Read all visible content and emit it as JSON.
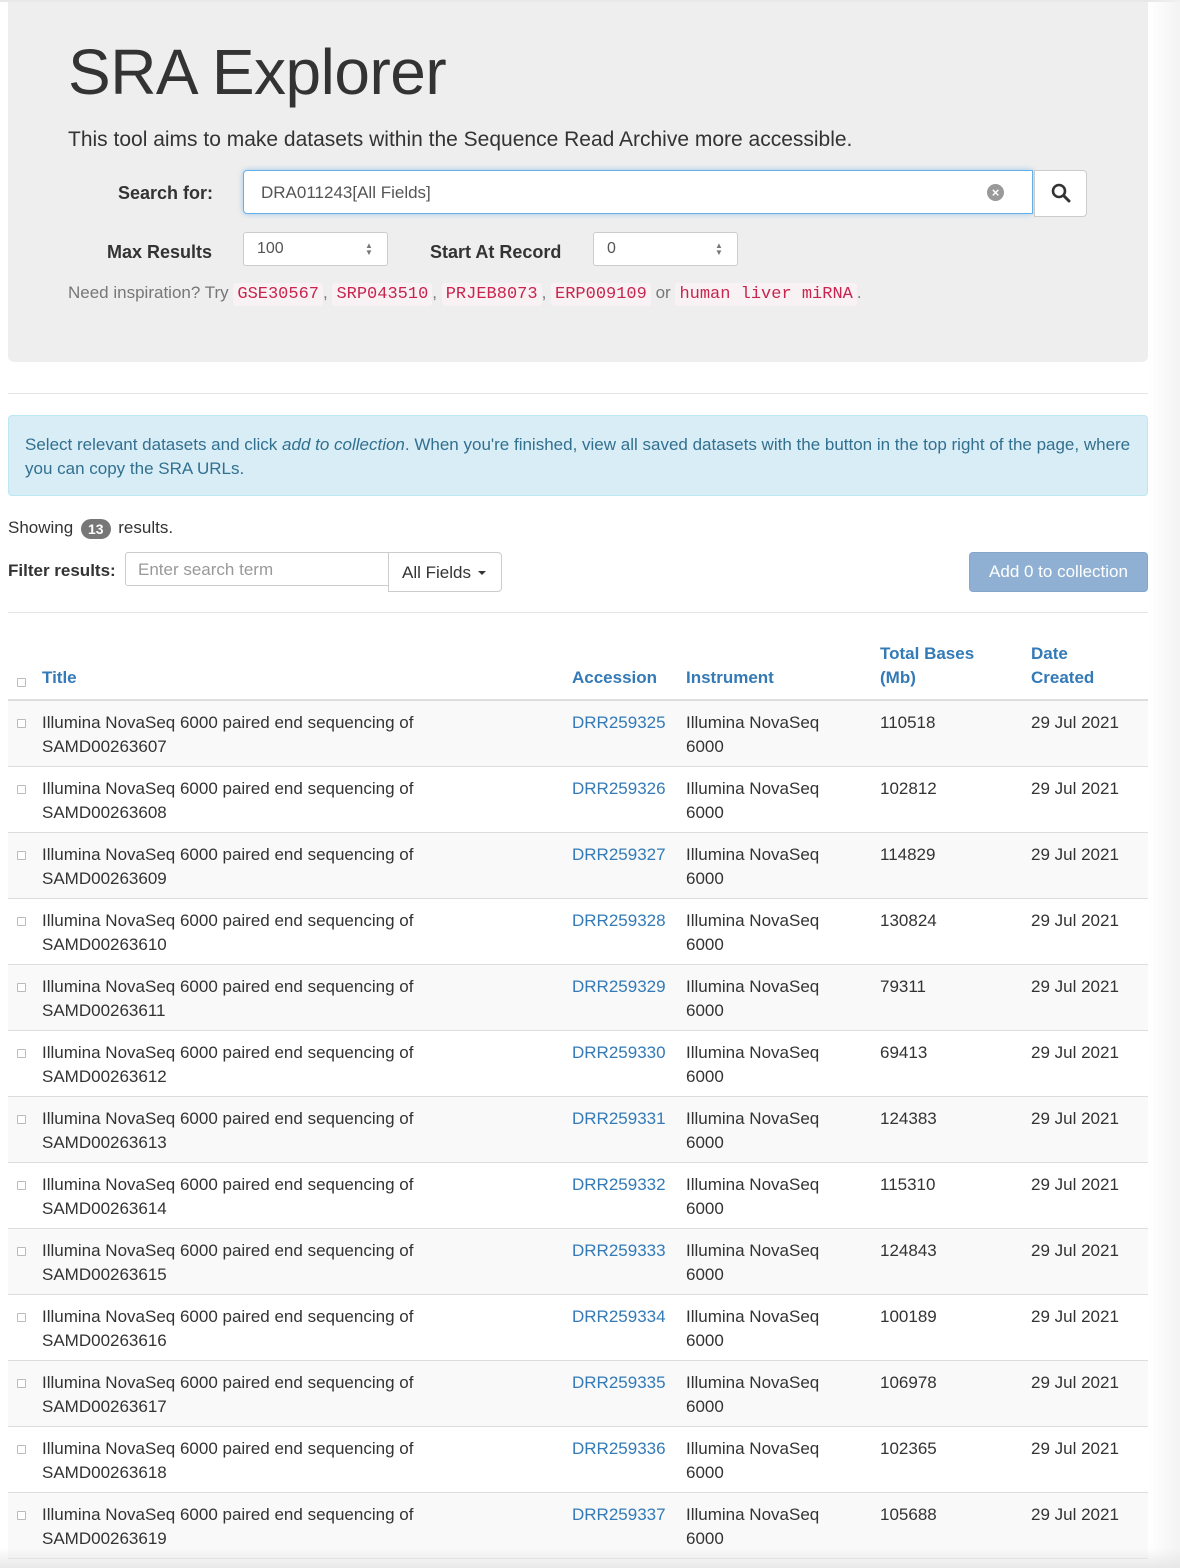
{
  "header": {
    "title": "SRA Explorer",
    "lead": "This tool aims to make datasets within the Sequence Read Archive more accessible."
  },
  "search": {
    "label": "Search for:",
    "value": "DRA011243[All Fields]",
    "clear_icon": "circle-x-icon",
    "button_icon": "magnifier-icon"
  },
  "max_results": {
    "label": "Max Results",
    "value": "100"
  },
  "start_record": {
    "label": "Start At Record",
    "value": "0"
  },
  "inspiration": {
    "prefix": "Need inspiration? Try",
    "examples": [
      "GSE30567",
      "SRP043510",
      "PRJEB8073",
      "ERP009109"
    ],
    "or_text": "or",
    "last_example": "human liver miRNA",
    "end": "."
  },
  "alert": {
    "before": "Select relevant datasets and click ",
    "em": "add to collection",
    "after": ". When you're finished, view all saved datasets with the button in the top right of the page, where you can copy the SRA URLs."
  },
  "showing": {
    "prefix": "Showing",
    "count": "13",
    "suffix": "results."
  },
  "filter": {
    "label": "Filter results:",
    "placeholder": "Enter search term",
    "fields_button": "All Fields",
    "add_button": "Add 0 to collection"
  },
  "table": {
    "headers": {
      "title": "Title",
      "accession": "Accession",
      "instrument": "Instrument",
      "bases_line1": "Total Bases",
      "bases_line2": "(Mb)",
      "date_line1": "Date",
      "date_line2": "Created"
    },
    "rows": [
      {
        "title1": "Illumina NovaSeq 6000 paired end sequencing of",
        "title2": "SAMD00263607",
        "accession": "DRR259325",
        "instrument1": "Illumina NovaSeq",
        "instrument2": "6000",
        "bases": "110518",
        "date": "29 Jul 2021"
      },
      {
        "title1": "Illumina NovaSeq 6000 paired end sequencing of",
        "title2": "SAMD00263608",
        "accession": "DRR259326",
        "instrument1": "Illumina NovaSeq",
        "instrument2": "6000",
        "bases": "102812",
        "date": "29 Jul 2021"
      },
      {
        "title1": "Illumina NovaSeq 6000 paired end sequencing of",
        "title2": "SAMD00263609",
        "accession": "DRR259327",
        "instrument1": "Illumina NovaSeq",
        "instrument2": "6000",
        "bases": "114829",
        "date": "29 Jul 2021"
      },
      {
        "title1": "Illumina NovaSeq 6000 paired end sequencing of",
        "title2": "SAMD00263610",
        "accession": "DRR259328",
        "instrument1": "Illumina NovaSeq",
        "instrument2": "6000",
        "bases": "130824",
        "date": "29 Jul 2021"
      },
      {
        "title1": "Illumina NovaSeq 6000 paired end sequencing of",
        "title2": "SAMD00263611",
        "accession": "DRR259329",
        "instrument1": "Illumina NovaSeq",
        "instrument2": "6000",
        "bases": "79311",
        "date": "29 Jul 2021"
      },
      {
        "title1": "Illumina NovaSeq 6000 paired end sequencing of",
        "title2": "SAMD00263612",
        "accession": "DRR259330",
        "instrument1": "Illumina NovaSeq",
        "instrument2": "6000",
        "bases": "69413",
        "date": "29 Jul 2021"
      },
      {
        "title1": "Illumina NovaSeq 6000 paired end sequencing of",
        "title2": "SAMD00263613",
        "accession": "DRR259331",
        "instrument1": "Illumina NovaSeq",
        "instrument2": "6000",
        "bases": "124383",
        "date": "29 Jul 2021"
      },
      {
        "title1": "Illumina NovaSeq 6000 paired end sequencing of",
        "title2": "SAMD00263614",
        "accession": "DRR259332",
        "instrument1": "Illumina NovaSeq",
        "instrument2": "6000",
        "bases": "115310",
        "date": "29 Jul 2021"
      },
      {
        "title1": "Illumina NovaSeq 6000 paired end sequencing of",
        "title2": "SAMD00263615",
        "accession": "DRR259333",
        "instrument1": "Illumina NovaSeq",
        "instrument2": "6000",
        "bases": "124843",
        "date": "29 Jul 2021"
      },
      {
        "title1": "Illumina NovaSeq 6000 paired end sequencing of",
        "title2": "SAMD00263616",
        "accession": "DRR259334",
        "instrument1": "Illumina NovaSeq",
        "instrument2": "6000",
        "bases": "100189",
        "date": "29 Jul 2021"
      },
      {
        "title1": "Illumina NovaSeq 6000 paired end sequencing of",
        "title2": "SAMD00263617",
        "accession": "DRR259335",
        "instrument1": "Illumina NovaSeq",
        "instrument2": "6000",
        "bases": "106978",
        "date": "29 Jul 2021"
      },
      {
        "title1": "Illumina NovaSeq 6000 paired end sequencing of",
        "title2": "SAMD00263618",
        "accession": "DRR259336",
        "instrument1": "Illumina NovaSeq",
        "instrument2": "6000",
        "bases": "102365",
        "date": "29 Jul 2021"
      },
      {
        "title1": "Illumina NovaSeq 6000 paired end sequencing of",
        "title2": "SAMD00263619",
        "accession": "DRR259337",
        "instrument1": "Illumina NovaSeq",
        "instrument2": "6000",
        "bases": "105688",
        "date": "29 Jul 2021"
      }
    ]
  },
  "colors": {
    "link": "#337ab7",
    "code": "#c7254e",
    "alert_bg": "#d9edf7",
    "alert_text": "#31708f",
    "jumbotron_bg": "#eeeeee",
    "button_disabled": "#8fb0d3"
  }
}
